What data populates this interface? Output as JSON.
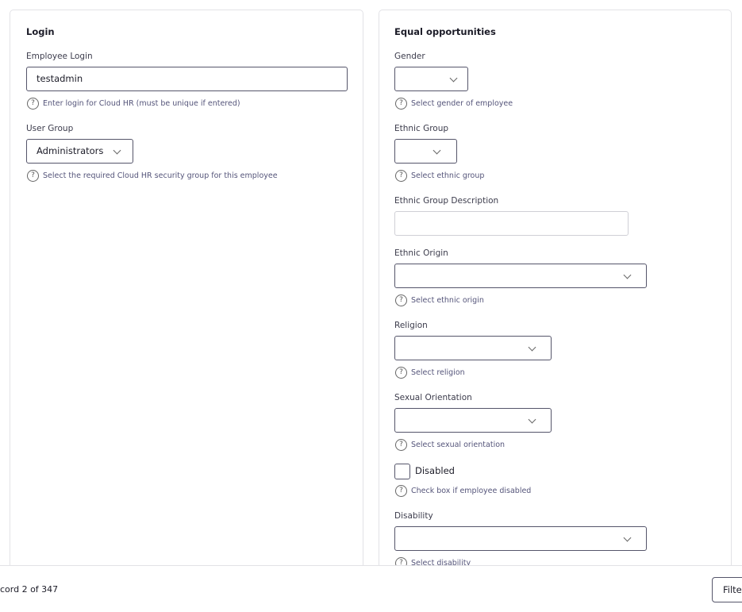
{
  "login": {
    "title": "Login",
    "employee_login_label": "Employee Login",
    "employee_login_value": "testadmin",
    "employee_login_help": "Enter login for Cloud HR (must be unique if entered)",
    "user_group_label": "User Group",
    "user_group_value": "Administrators",
    "user_group_help": "Select the required Cloud HR security group for this employee"
  },
  "eo": {
    "title": "Equal opportunities",
    "gender_label": "Gender",
    "gender_help": "Select gender of employee",
    "ethnic_group_label": "Ethnic Group",
    "ethnic_group_help": "Select ethnic group",
    "ethnic_desc_label": "Ethnic Group Description",
    "ethnic_origin_label": "Ethnic Origin",
    "ethnic_origin_help": "Select ethnic origin",
    "religion_label": "Religion",
    "religion_help": "Select religion",
    "sexual_orientation_label": "Sexual Orientation",
    "sexual_orientation_help": "Select sexual orientation",
    "disabled_label": "Disabled",
    "disabled_checked": false,
    "disabled_help": "Check box if employee disabled",
    "disability_label": "Disability",
    "disability_help": "Select disability"
  },
  "footer": {
    "record_text": "cord 2 of 347",
    "filter_label": "Filte"
  }
}
